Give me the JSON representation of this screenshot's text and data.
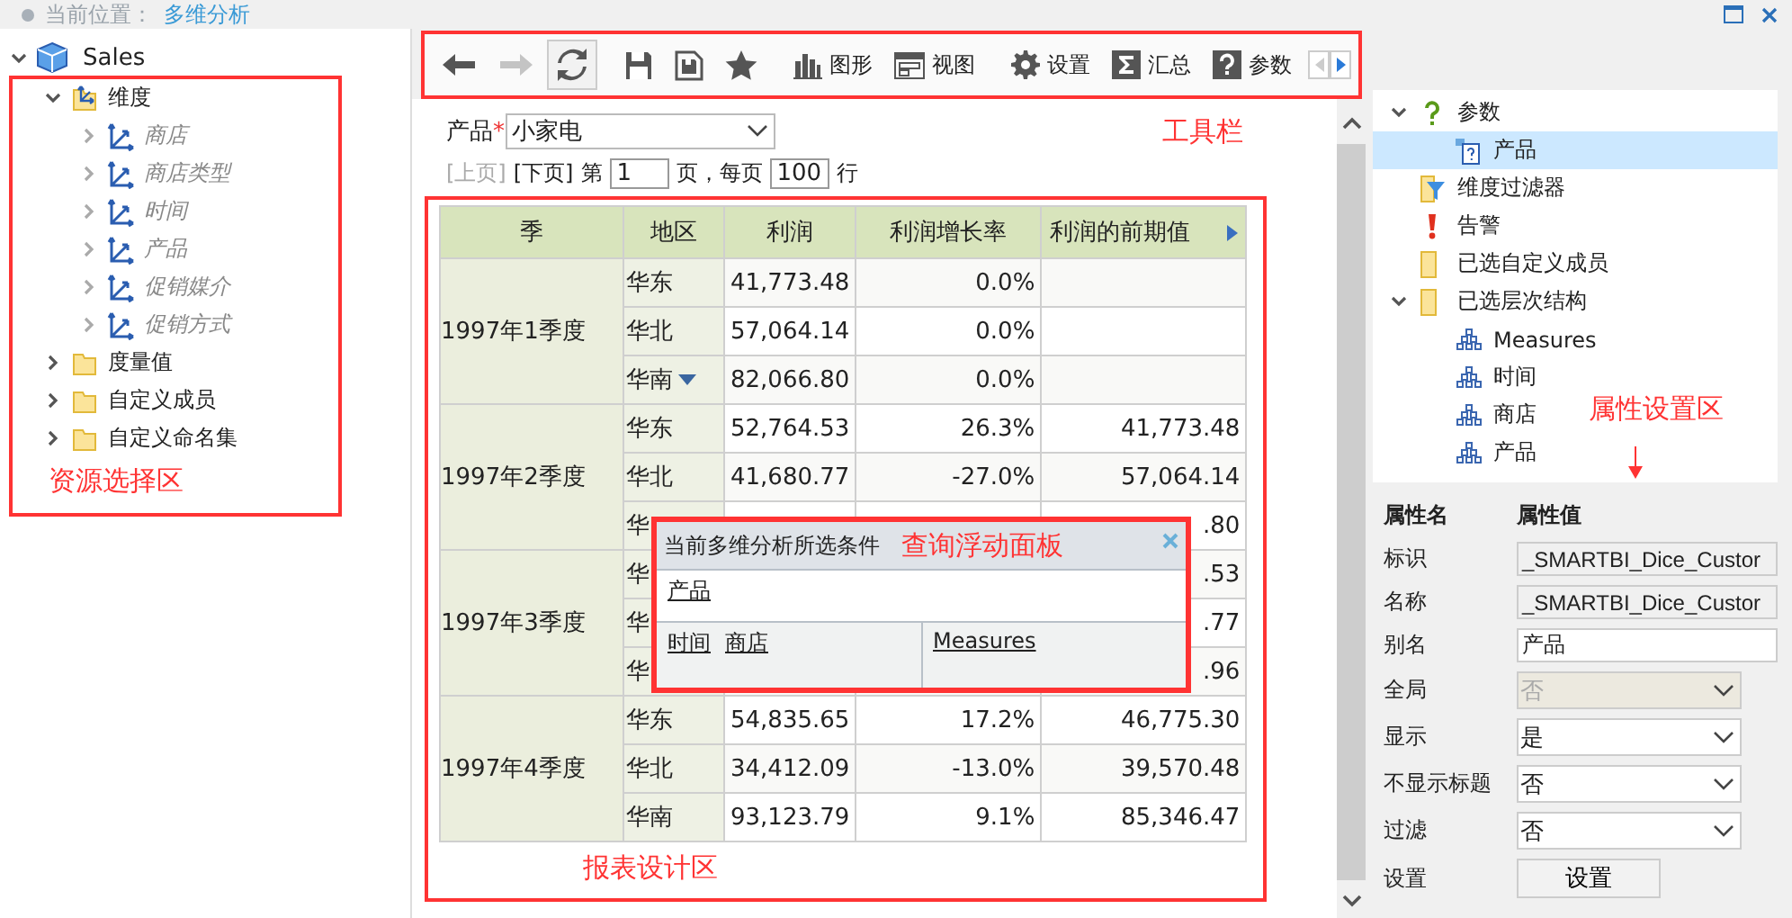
{
  "breadcrumb": {
    "label": "当前位置：",
    "current": "多维分析"
  },
  "resource_tree": {
    "label": "Sales",
    "expanded": true,
    "children": [
      {
        "label": "维度",
        "kind": "dimension-folder",
        "expanded": true,
        "children": [
          {
            "label": "商店",
            "kind": "dimension",
            "expanded": false
          },
          {
            "label": "商店类型",
            "kind": "dimension",
            "expanded": false
          },
          {
            "label": "时间",
            "kind": "dimension",
            "expanded": false
          },
          {
            "label": "产品",
            "kind": "dimension",
            "expanded": false
          },
          {
            "label": "促销媒介",
            "kind": "dimension",
            "expanded": false
          },
          {
            "label": "促销方式",
            "kind": "dimension",
            "expanded": false
          }
        ]
      },
      {
        "label": "度量值",
        "kind": "folder",
        "expanded": false
      },
      {
        "label": "自定义成员",
        "kind": "folder",
        "expanded": false
      },
      {
        "label": "自定义命名集",
        "kind": "folder",
        "expanded": false
      }
    ]
  },
  "toolbar": {
    "groups": [
      [
        {
          "kind": "back",
          "disabled": false,
          "pressed": false
        },
        {
          "kind": "forward",
          "disabled": true,
          "pressed": false
        },
        {
          "kind": "refresh",
          "disabled": false,
          "pressed": true
        }
      ],
      [
        {
          "kind": "save",
          "disabled": false,
          "pressed": false
        },
        {
          "kind": "save-as",
          "disabled": false,
          "pressed": false
        },
        {
          "kind": "favorite",
          "disabled": false,
          "pressed": false
        }
      ],
      [
        {
          "kind": "chart",
          "label": "图形",
          "disabled": false,
          "pressed": false
        },
        {
          "kind": "view",
          "label": "视图",
          "disabled": false,
          "pressed": false
        }
      ],
      [
        {
          "kind": "settings",
          "label": "设置",
          "disabled": false,
          "pressed": false
        },
        {
          "kind": "sum",
          "label": "汇总",
          "disabled": false,
          "pressed": false
        },
        {
          "kind": "params",
          "label": "参数",
          "disabled": false,
          "pressed": false
        }
      ]
    ]
  },
  "parameter": {
    "label": "产品",
    "required_mark": "*",
    "value": "小家电"
  },
  "pager": {
    "prev": "[上页]",
    "prev_disabled": true,
    "next": "[下页]",
    "page_label": "第",
    "page": "1",
    "per_page_label": "页，每页",
    "per_page": "100",
    "rows_label": "行"
  },
  "table": {
    "columns": [
      {
        "label": "季",
        "more_arrow": false
      },
      {
        "label": "地区",
        "more_arrow": false
      },
      {
        "label": "利润",
        "more_arrow": false
      },
      {
        "label": "利润增长率",
        "more_arrow": false
      },
      {
        "label": "利润的前期值",
        "more_arrow": true
      }
    ],
    "groups": [
      {
        "quarter": "1997年1季度",
        "rows": [
          {
            "region": "华东",
            "profit": "41,773.48",
            "growth": "0.0%",
            "menu": false
          },
          {
            "region": "华北",
            "profit": "57,064.14",
            "growth": "0.0%",
            "menu": false
          },
          {
            "region": "华南",
            "profit": "82,066.80",
            "growth": "0.0%",
            "menu": true
          }
        ]
      },
      {
        "quarter": "1997年2季度",
        "rows": [
          {
            "region": "华东",
            "profit": "52,764.53",
            "growth": "26.3%",
            "prev": "41,773.48",
            "menu": false
          },
          {
            "region": "华北",
            "profit": "41,680.77",
            "growth": "-27.0%",
            "prev": "57,064.14",
            "menu": false
          },
          {
            "region": "华",
            "prev": ".80",
            "menu": false
          }
        ]
      },
      {
        "quarter": "1997年3季度",
        "rows": [
          {
            "region": "华",
            "prev": ".53",
            "menu": false
          },
          {
            "region": "华",
            "prev": ".77",
            "menu": false
          },
          {
            "region": "华",
            "prev": ".96",
            "menu": false
          }
        ]
      },
      {
        "quarter": "1997年4季度",
        "rows": [
          {
            "region": "华东",
            "profit": "54,835.65",
            "growth": "17.2%",
            "prev": "46,775.30",
            "menu": false
          },
          {
            "region": "华北",
            "profit": "34,412.09",
            "growth": "-13.0%",
            "prev": "39,570.48",
            "menu": false
          },
          {
            "region": "华南",
            "profit": "93,123.79",
            "growth": "9.1%",
            "prev": "85,346.47",
            "menu": false
          }
        ]
      }
    ]
  },
  "floating_panel": {
    "title": "当前多维分析所选条件",
    "filter_items": [
      "产品"
    ],
    "row_items": [
      "时间",
      "商店"
    ],
    "column_items": [
      "Measures"
    ]
  },
  "query_tree": [
    {
      "label": "参数",
      "kind": "param",
      "expanded": true,
      "selected": false,
      "children": [
        {
          "label": "产品",
          "kind": "param-item",
          "selected": true
        }
      ]
    },
    {
      "label": "维度过滤器",
      "kind": "filter",
      "selected": false
    },
    {
      "label": "告警",
      "kind": "alert",
      "selected": false
    },
    {
      "label": "已选自定义成员",
      "kind": "folder",
      "selected": false
    },
    {
      "label": "已选层次结构",
      "kind": "folder",
      "expanded": true,
      "selected": false,
      "children": [
        {
          "label": "Measures",
          "kind": "hierarchy",
          "selected": false
        },
        {
          "label": "时间",
          "kind": "hierarchy",
          "selected": false
        },
        {
          "label": "商店",
          "kind": "hierarchy",
          "selected": false
        },
        {
          "label": "产品",
          "kind": "hierarchy",
          "selected": false
        }
      ]
    }
  ],
  "properties": {
    "name_header": "属性名",
    "value_header": "属性值",
    "rows": [
      {
        "name": "标识",
        "kind": "text",
        "value": "_SMARTBI_Dice_Custor",
        "readonly": true
      },
      {
        "name": "名称",
        "kind": "text",
        "value": "_SMARTBI_Dice_Custor",
        "readonly": true
      },
      {
        "name": "别名",
        "kind": "text",
        "value": "产品",
        "readonly": false
      },
      {
        "name": "全局",
        "kind": "select",
        "value": "否",
        "disabled": true
      },
      {
        "name": "显示",
        "kind": "select",
        "value": "是",
        "disabled": false
      },
      {
        "name": "不显示标题",
        "kind": "select",
        "value": "否",
        "disabled": false
      },
      {
        "name": "过滤",
        "kind": "select",
        "value": "否",
        "disabled": false
      },
      {
        "name": "设置",
        "kind": "button",
        "value": "设置"
      }
    ]
  },
  "annotations": {
    "resource_area": "资源选择区",
    "toolbar": "工具栏",
    "report_area": "报表设计区",
    "floating_panel": "查询浮动面板",
    "property_area": "属性设置区"
  }
}
